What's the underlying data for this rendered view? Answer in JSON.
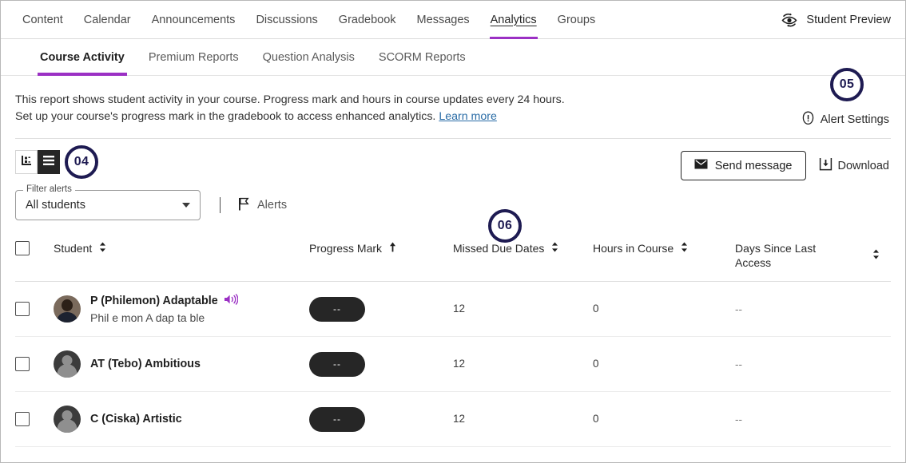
{
  "topnav": {
    "items": [
      {
        "label": "Content",
        "active": false
      },
      {
        "label": "Calendar",
        "active": false
      },
      {
        "label": "Announcements",
        "active": false
      },
      {
        "label": "Discussions",
        "active": false
      },
      {
        "label": "Gradebook",
        "active": false
      },
      {
        "label": "Messages",
        "active": false
      },
      {
        "label": "Analytics",
        "active": true
      },
      {
        "label": "Groups",
        "active": false
      }
    ],
    "student_preview_label": "Student Preview"
  },
  "subnav": {
    "items": [
      {
        "label": "Course Activity",
        "active": true
      },
      {
        "label": "Premium Reports",
        "active": false
      },
      {
        "label": "Question Analysis",
        "active": false
      },
      {
        "label": "SCORM Reports",
        "active": false
      }
    ]
  },
  "description": {
    "line1": "This report shows student activity in your course. Progress mark and hours in course updates every 24 hours.",
    "line2_prefix": "Set up your course's progress mark in the gradebook to access enhanced analytics. ",
    "link_text": "Learn more"
  },
  "alert_settings": {
    "label": "Alert Settings",
    "badge": "05"
  },
  "toolbar": {
    "chart_view_icon": "bar-chart-icon",
    "list_view_icon": "list-view-icon",
    "badge": "04",
    "send_message_label": "Send message",
    "download_label": "Download"
  },
  "filter": {
    "legend": "Filter alerts",
    "value": "All students",
    "options": [
      "All students"
    ],
    "alerts_label": "Alerts"
  },
  "table": {
    "badge_missed": "06",
    "columns": [
      {
        "label": "Student",
        "sort": "none"
      },
      {
        "label": "Progress Mark",
        "sort": "asc"
      },
      {
        "label": "Missed Due Dates",
        "sort": "none"
      },
      {
        "label": "Hours in Course",
        "sort": "none"
      },
      {
        "label": "Days Since Last Access",
        "sort": "none"
      }
    ],
    "rows": [
      {
        "name": "P (Philemon) Adaptable",
        "pronunciation": "Phil e mon A dap ta ble",
        "has_audio": true,
        "avatar_type": "photo",
        "progress_mark": "--",
        "missed_due_dates": "12",
        "hours_in_course": "0",
        "days_since_last_access": "--"
      },
      {
        "name": "AT (Tebo) Ambitious",
        "pronunciation": "",
        "has_audio": false,
        "avatar_type": "dark",
        "progress_mark": "--",
        "missed_due_dates": "12",
        "hours_in_course": "0",
        "days_since_last_access": "--"
      },
      {
        "name": "C (Ciska) Artistic",
        "pronunciation": "",
        "has_audio": false,
        "avatar_type": "dark",
        "progress_mark": "--",
        "missed_due_dates": "12",
        "hours_in_course": "0",
        "days_since_last_access": "--"
      }
    ]
  },
  "colors": {
    "accent_purple": "#9b30c4",
    "badge_navy": "#1e1b52",
    "link_blue": "#2a6ca6",
    "pill_dark": "#262626"
  }
}
